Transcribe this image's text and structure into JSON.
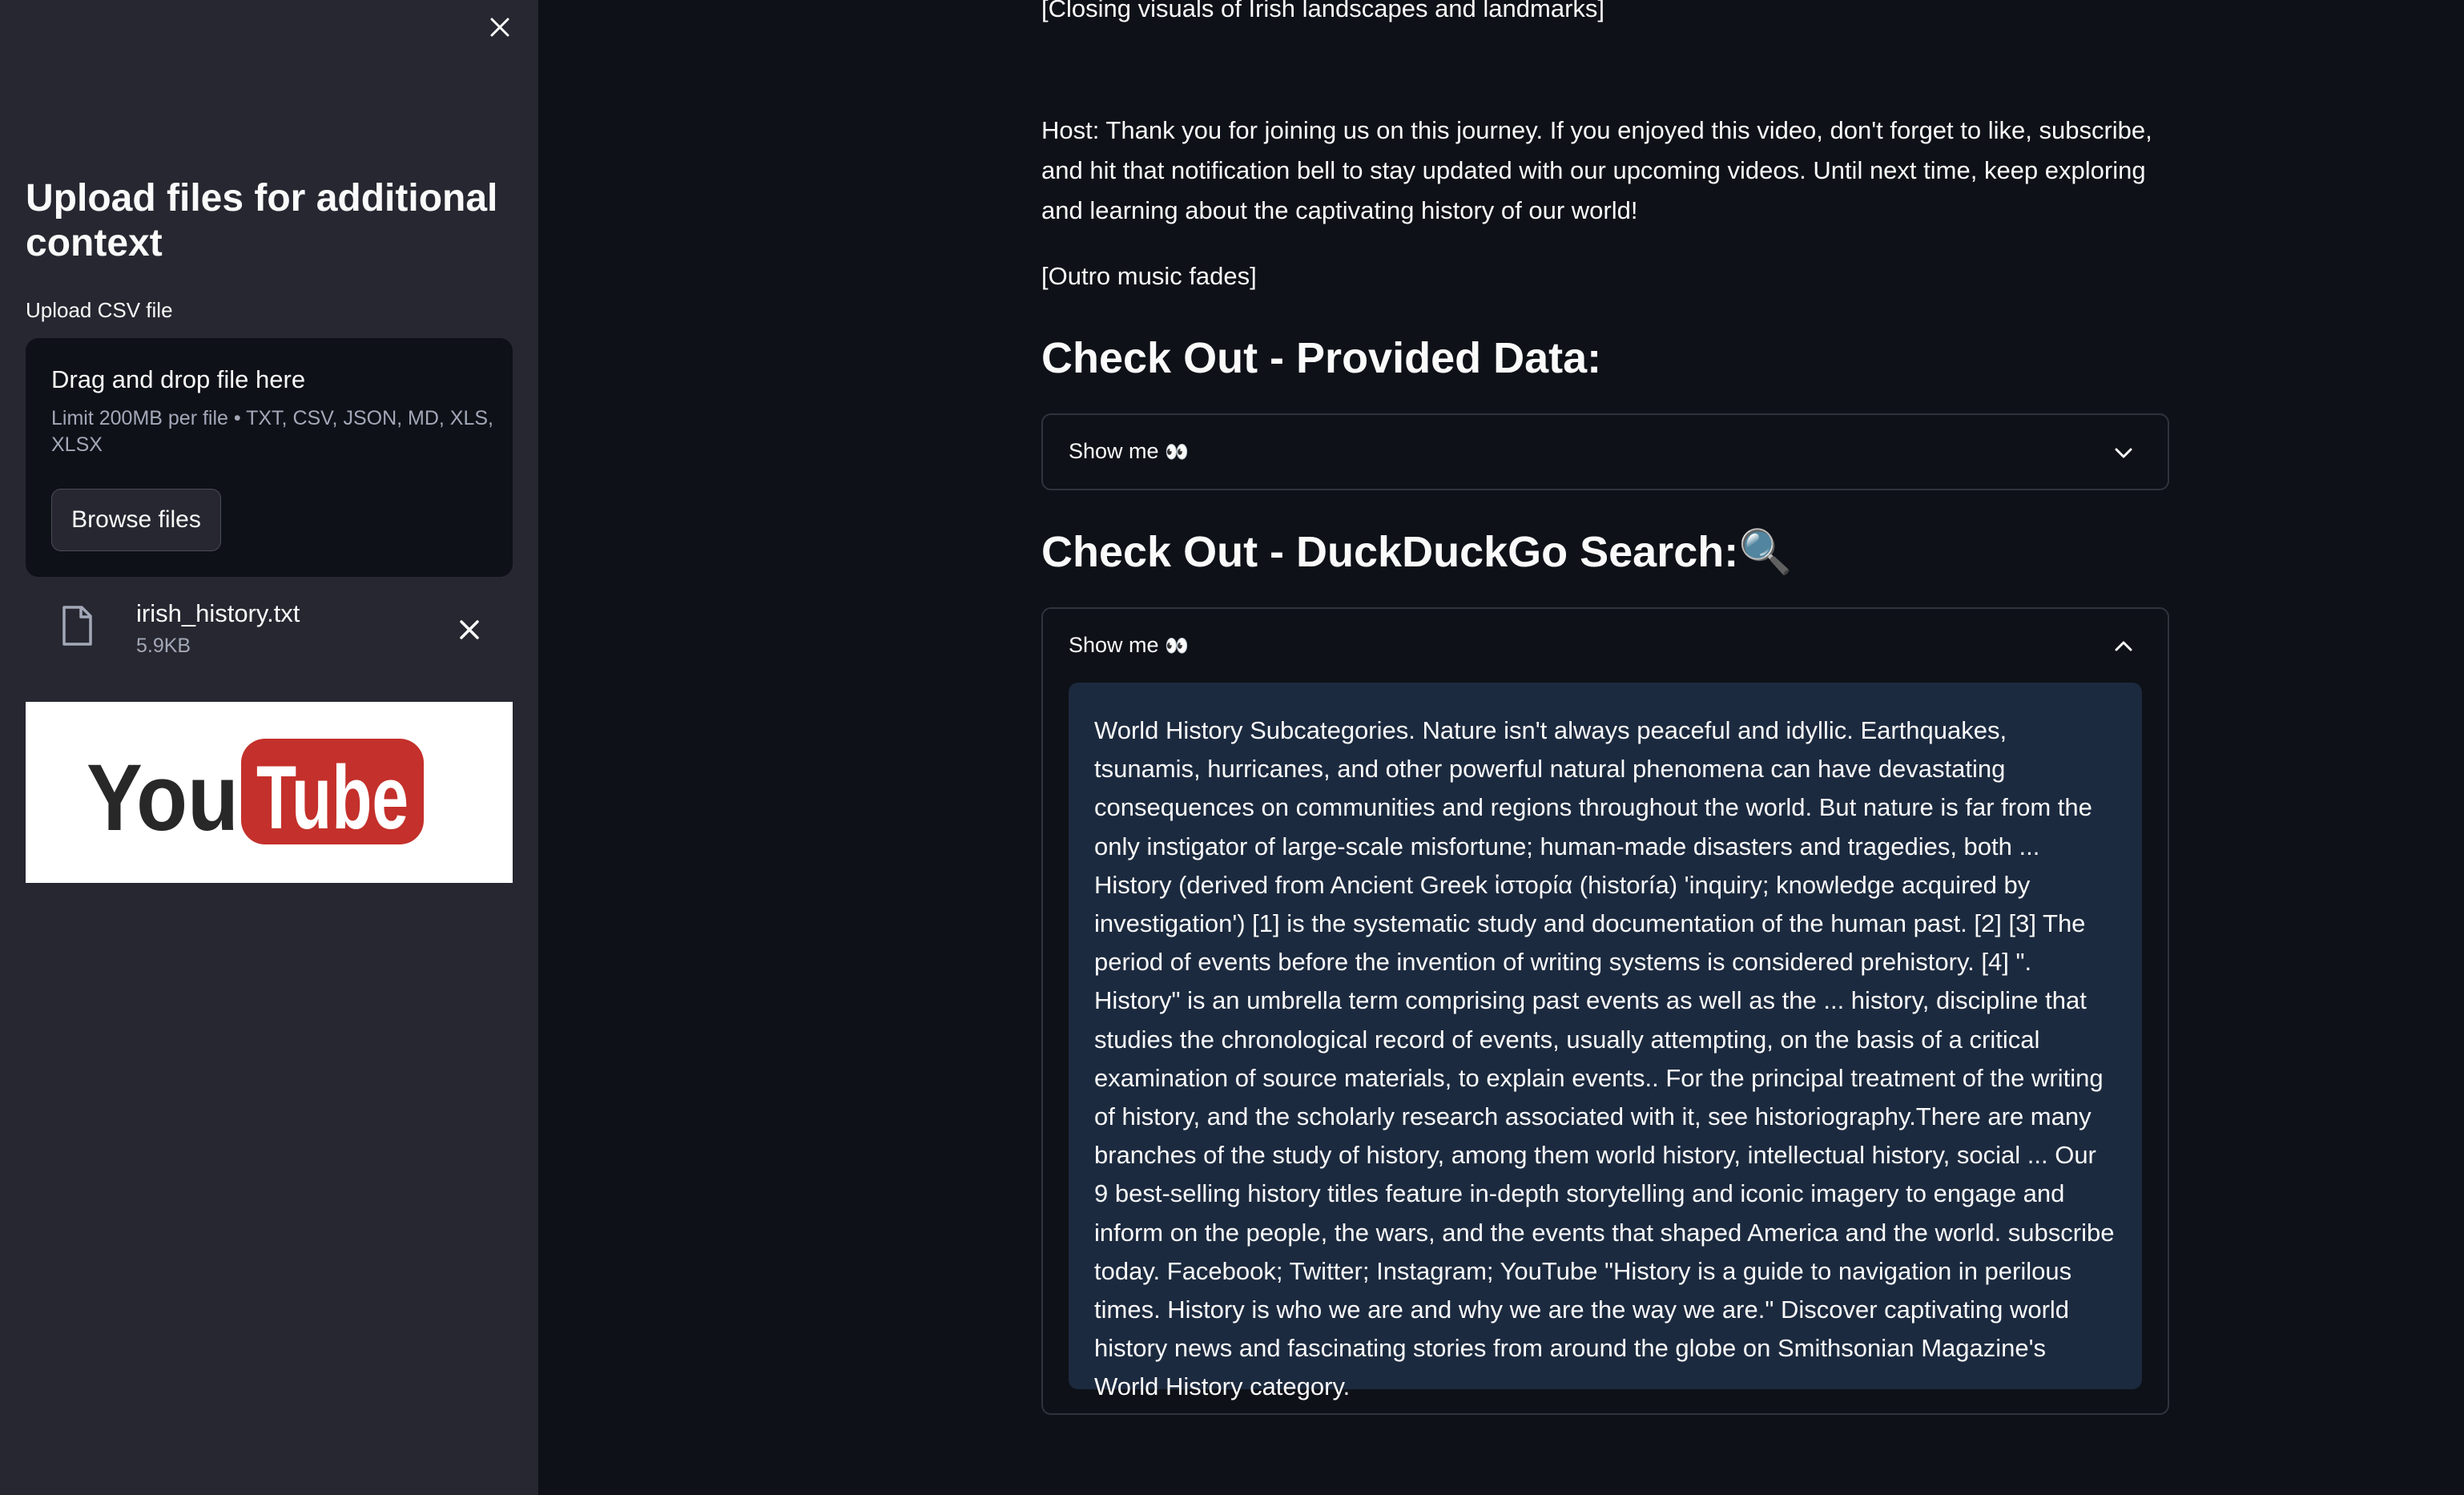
{
  "sidebar": {
    "title": "Upload files for additional context",
    "upload_label": "Upload CSV file",
    "dropzone": {
      "title": "Drag and drop file here",
      "limit": "Limit 200MB per file • TXT, CSV, JSON, MD, XLS, XLSX",
      "browse_label": "Browse files"
    },
    "file": {
      "name": "irish_history.txt",
      "size": "5.9KB"
    },
    "logo": {
      "you": "You",
      "tube": "Tube"
    }
  },
  "main": {
    "closing_visuals": "[Closing visuals of Irish landscapes and landmarks]",
    "host_text": "Host: Thank you for joining us on this journey. If you enjoyed this video, don't forget to like, subscribe, and hit that notification bell to stay updated with our upcoming videos. Until next time, keep exploring and learning about the captivating history of our world!",
    "outro": "[Outro music fades]",
    "provided_heading": "Check Out - Provided Data:",
    "provided_expander": {
      "label": "Show me",
      "eyes": "👀",
      "expanded": false
    },
    "search_heading": "Check Out - DuckDuckGo Search:",
    "search_heading_icon": "🔍",
    "search_expander": {
      "label": "Show me",
      "eyes": "👀",
      "expanded": true
    },
    "search_result": "World History Subcategories. Nature isn't always peaceful and idyllic. Earthquakes, tsunamis, hurricanes, and other powerful natural phenomena can have devastating consequences on communities and regions throughout the world. But nature is far from the only instigator of large-scale misfortune; human-made disasters and tragedies, both ... History (derived from Ancient Greek ἱστορία (historía) 'inquiry; knowledge acquired by investigation') [1] is the systematic study and documentation of the human past. [2] [3] The period of events before the invention of writing systems is considered prehistory. [4] \". History\" is an umbrella term comprising past events as well as the ... history, discipline that studies the chronological record of events, usually attempting, on the basis of a critical examination of source materials, to explain events.. For the principal treatment of the writing of history, and the scholarly research associated with it, see historiography.There are many branches of the study of history, among them world history, intellectual history, social ... Our 9 best-selling history titles feature in-depth storytelling and iconic imagery to engage and inform on the people, the wars, and the events that shaped America and the world. subscribe today. Facebook; Twitter; Instagram; YouTube \"History is a guide to navigation in perilous times. History is who we are and why we are the way we are.\" Discover captivating world history news and fascinating stories from around the globe on Smithsonian Magazine's World History category."
  },
  "colors": {
    "background": "#0e1117",
    "sidebar": "#262730",
    "code_block": "#1c2a3f",
    "youtube_red": "#c4302b"
  }
}
